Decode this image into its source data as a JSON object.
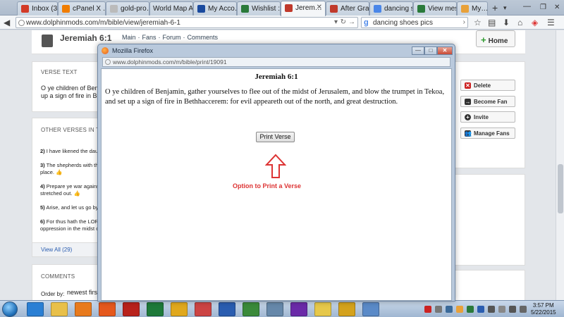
{
  "browser": {
    "tabs": [
      {
        "label": "Inbox (35…",
        "color": "#d33b27"
      },
      {
        "label": "cPanel X …",
        "color": "#f07d00"
      },
      {
        "label": "gold-pro…",
        "color": "#999999"
      },
      {
        "label": "World Map A…",
        "color": "#999999"
      },
      {
        "label": "My Acco…",
        "color": "#1a4a9e"
      },
      {
        "label": "Wishlist :…",
        "color": "#2a7a3a"
      },
      {
        "label": "Jerem…",
        "color": "#c0392b"
      },
      {
        "label": "After Gra…",
        "color": "#c0392b"
      },
      {
        "label": "dancing s…",
        "color": "#4a86e8"
      },
      {
        "label": "View mes…",
        "color": "#2a7a3a"
      },
      {
        "label": "My…",
        "color": "#e8a13a"
      }
    ],
    "url": "www.dolphinmods.com/m/bible/view/jeremiah-6-1",
    "search": "dancing shoes pics"
  },
  "page": {
    "title": "Jeremiah 6:1",
    "subnav": [
      "Main",
      "·",
      "Fans",
      "·",
      "Forum",
      "·",
      "Comments"
    ],
    "home_label": "Home",
    "verse_text_heading": "VERSE TEXT",
    "verse_text_lines": [
      "O ye children of Benj",
      "up a sign of fire in Be"
    ],
    "other_verses_heading": "OTHER VERSES IN TH",
    "other_verses": [
      {
        "num": "2)",
        "text": "I have likened the dau"
      },
      {
        "num": "3)",
        "text": "The shepherds with th",
        "cont": "place."
      },
      {
        "num": "4)",
        "text": "Prepare ye war agains",
        "cont": "stretched out."
      },
      {
        "num": "5)",
        "text": "Arise, and let us go by"
      },
      {
        "num": "6)",
        "text": "For thus hath the LOR",
        "cont": "oppression in the midst o"
      }
    ],
    "view_all": "View All (29)",
    "comments_heading": "COMMENTS",
    "order_label": "Order by:",
    "order_value": "newest first",
    "side_buttons": [
      "Delete",
      "Become Fan",
      "Invite",
      "Manage Fans"
    ]
  },
  "popup": {
    "window_title": "Mozilla Firefox",
    "url": "www.dolphinmods.com/m/bible/print/19091",
    "verse_title": "Jeremiah 6:1",
    "verse_text": "O ye children of Benjamin, gather yourselves to flee out of the midst of Jerusalem, and blow the trumpet in Tekoa, and set up a sign of fire in Bethhaccerem: for evil appeareth out of the north, and great destruction.",
    "print_button": "Print Verse",
    "annotation": "Option to Print a Verse"
  },
  "taskbar": {
    "time": "3:57 PM",
    "date": "5/22/2015",
    "apps": [
      "ie-icon",
      "explorer-icon",
      "media-player-icon",
      "firefox-icon",
      "filezilla-icon",
      "excel-icon",
      "chrome-icon",
      "paint-icon",
      "word-icon",
      "frog-icon",
      "ab-icon",
      "media-icon",
      "sticky-icon",
      "ue-icon",
      "paint-brush-icon"
    ],
    "app_colors": [
      "#2a7fd4",
      "#e8c04a",
      "#e87a1d",
      "#e5581d",
      "#b8221c",
      "#1e7a3a",
      "#e0a81d",
      "#c44",
      "#2a5db0",
      "#3a8a3a",
      "#6688aa",
      "#6a2aa8",
      "#e6c84a",
      "#d4a21d",
      "#5a8ac8"
    ]
  }
}
